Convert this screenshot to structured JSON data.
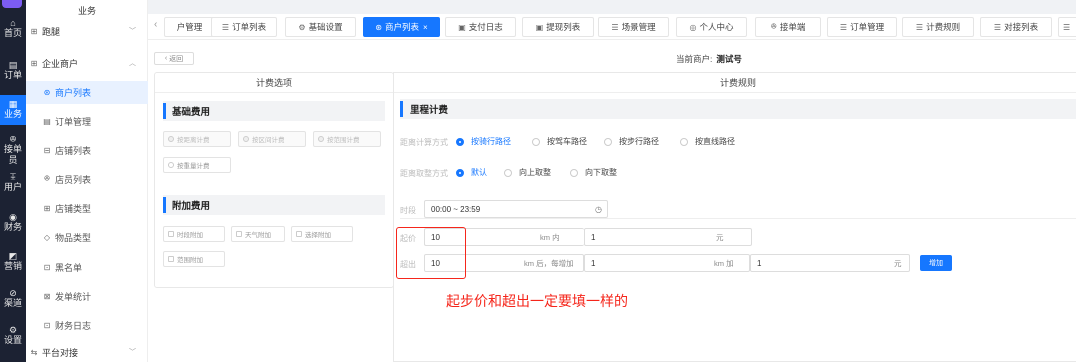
{
  "rail": {
    "items": [
      {
        "label": "首页",
        "icon": "⌂"
      },
      {
        "label": "订单",
        "icon": "▤"
      },
      {
        "label": "业务",
        "icon": "▦"
      },
      {
        "label": "接单员",
        "icon": "ꔮ"
      },
      {
        "label": "用户",
        "icon": "ꔯ"
      },
      {
        "label": "财务",
        "icon": "◉"
      },
      {
        "label": "营销",
        "icon": "◩"
      },
      {
        "label": "渠道",
        "icon": "⊘"
      },
      {
        "label": "设置",
        "icon": "⚙"
      }
    ]
  },
  "sidebar": {
    "header": "业务",
    "group1": "跑腿",
    "group2": "企业商户",
    "items": [
      {
        "label": "商户列表",
        "icon": "⊛"
      },
      {
        "label": "订单管理",
        "icon": "▤"
      },
      {
        "label": "店铺列表",
        "icon": "⊟"
      },
      {
        "label": "店员列表",
        "icon": "ꔮ"
      },
      {
        "label": "店铺类型",
        "icon": "⊞"
      },
      {
        "label": "物品类型",
        "icon": "◇"
      },
      {
        "label": "黑名单",
        "icon": "⊡"
      },
      {
        "label": "发单统计",
        "icon": "⊠"
      },
      {
        "label": "财务日志",
        "icon": "⊡"
      }
    ],
    "group3": "平台对接"
  },
  "tabs": [
    {
      "label": "户管理",
      "icon": ""
    },
    {
      "label": "订单列表",
      "icon": "☰"
    },
    {
      "label": "基础设置",
      "icon": "⚙"
    },
    {
      "label": "商户列表",
      "icon": "⊛",
      "active": true
    },
    {
      "label": "支付日志",
      "icon": "▣"
    },
    {
      "label": "提现列表",
      "icon": "▣"
    },
    {
      "label": "场景管理",
      "icon": "☰"
    },
    {
      "label": "个人中心",
      "icon": "◎"
    },
    {
      "label": "接单端",
      "icon": "ꔮ"
    },
    {
      "label": "订单管理",
      "icon": "☰"
    },
    {
      "label": "计费规则",
      "icon": "☰"
    },
    {
      "label": "对接列表",
      "icon": "☰"
    }
  ],
  "content": {
    "back": "返回",
    "merchant_label": "当前商户:",
    "merchant_name": "测试号"
  },
  "left_panel": {
    "title": "计费选项",
    "base_section": "基础费用",
    "base_options": [
      "按距离计费",
      "按区间计费",
      "按范围计费",
      "按重量计费"
    ],
    "extra_section": "附加费用",
    "extra_options": [
      "时段附加",
      "天气附加",
      "选择附加",
      "范围附加"
    ]
  },
  "right_panel": {
    "title": "计费规则",
    "section": "里程计费",
    "distance_method_label": "距离计算方式",
    "distance_methods": [
      "按骑行路径",
      "按驾车路径",
      "按步行路径",
      "按直线路径"
    ],
    "rounding_label": "距离取整方式",
    "rounding_methods": [
      "默认",
      "向上取整",
      "向下取整"
    ],
    "period_label": "时段",
    "period_value": "00:00 ~ 23:59",
    "start_label": "起价",
    "start_price": "10",
    "start_km_suffix": "km 内",
    "start_km": "1",
    "start_unit": "元",
    "over_label": "超出",
    "over_price": "10",
    "over_km_suffix": "km 后，每增加",
    "over_km": "1",
    "over_add_suffix": "km 加",
    "over_add": "1",
    "over_unit": "元",
    "add_button": "增加"
  },
  "annotation": "起步价和超出一定要填一样的",
  "colors": {
    "accent": "#1677ff",
    "annotation": "#f5261b",
    "rail": "#1c2233"
  }
}
